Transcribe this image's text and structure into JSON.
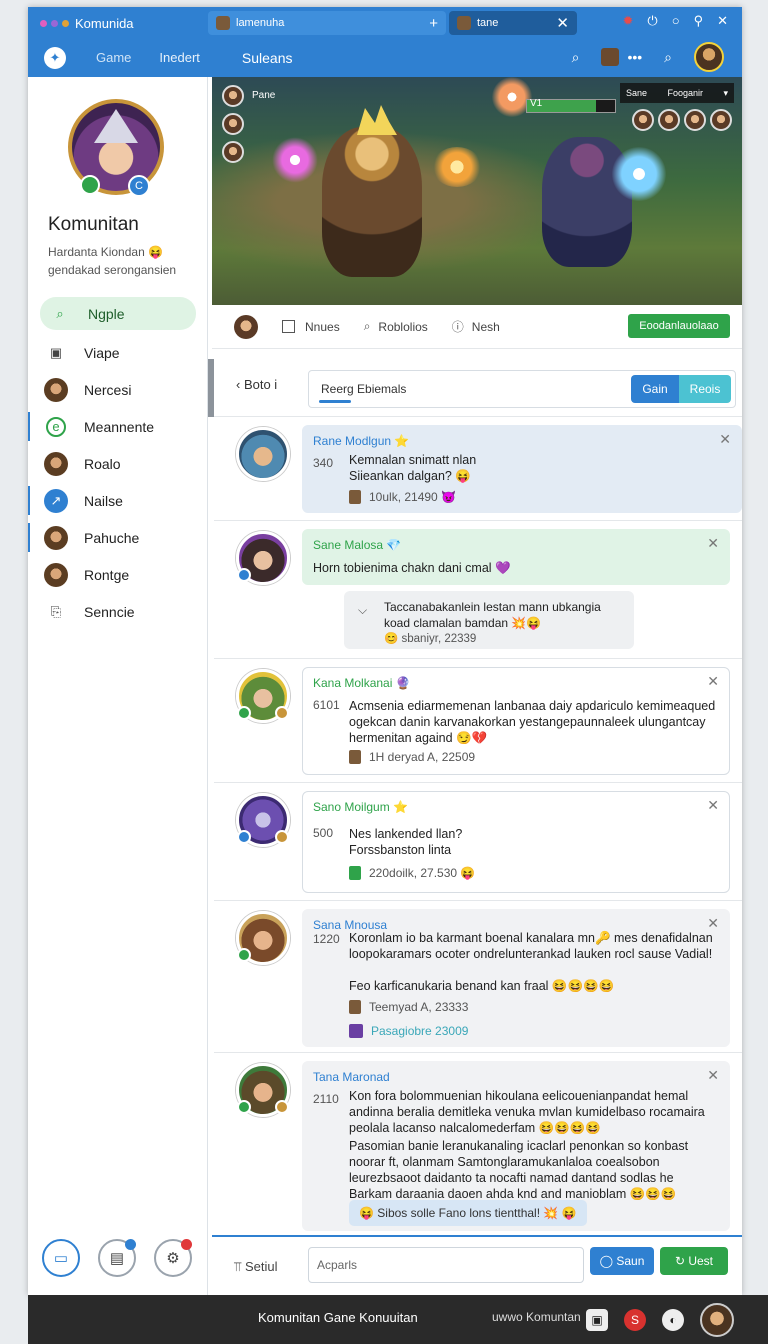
{
  "window": {
    "title": "Komunida",
    "tabs": [
      {
        "label": "lamenuha",
        "icon": "plus-icon"
      },
      {
        "label": "tane",
        "icon": "close-icon"
      }
    ],
    "dot_colors": [
      "#e05fbf",
      "#9a67d6",
      "#e0a238"
    ]
  },
  "toolbar": {
    "nav": [
      "Game",
      "Inedert"
    ],
    "title": "Suleans"
  },
  "profile": {
    "name": "Komunitan",
    "subtitle": "Hardanta Kiondan 😝 gendakad serongansien",
    "badge_b": "C"
  },
  "sidebar": {
    "items": [
      {
        "label": "Ngple",
        "icon": "search-icon",
        "active": true
      },
      {
        "label": "Viape",
        "icon": "calendar-icon"
      },
      {
        "label": "Nercesi",
        "icon": "avatar-icon"
      },
      {
        "label": "Meannente",
        "icon": "circle-icon"
      },
      {
        "label": "Roalo",
        "icon": "avatar-icon"
      },
      {
        "label": "Nailse",
        "icon": "share-icon"
      },
      {
        "label": "Pahuche",
        "icon": "avatar-icon"
      },
      {
        "label": "Rontge",
        "icon": "avatar-icon"
      },
      {
        "label": "Senncie",
        "icon": "clipboard-icon"
      }
    ]
  },
  "banner": {
    "player_name": "Pane",
    "hp_label": "V1",
    "hp_fraction": 0.78,
    "box_left": "Sane",
    "box_right": "Fooganir"
  },
  "actions": {
    "items": [
      "Nnues",
      "Roblolios",
      "Nesh"
    ],
    "button": "Eoodanlauolaao"
  },
  "feed": {
    "back": "Boto i",
    "search": "Reerg Ebiemals",
    "seg": [
      "Gain",
      "Reois"
    ]
  },
  "posts": [
    {
      "name": "Rane Modlgun ⭐",
      "num": "340",
      "text": "Kemnalan snimatt nlan Siieankan dalgan? 😝",
      "meta": "10ulk, 21490 😈"
    },
    {
      "name": "Sane Malosa 💎",
      "text": "Horn tobienima chakn dani cmal 💜",
      "reply_text": "Taccanabakanlein lestan mann ubkangia koad clamalan bamdan 💥😝",
      "reply_meta": "😊 sbaniyr, 22339"
    },
    {
      "name": "Kana Molkanai 🔮",
      "num": "6101",
      "text": "Acmsenia ediarmemenan lanbanaa daiy apdariculo kemimeaqued ogekcan danin karvanakorkan yestangepaunnaleek ulungantcay hermenitan againd 😏💔",
      "meta": "1H deryad A, 22509"
    },
    {
      "name": "Sano Moilgum ⭐",
      "num": "500",
      "text": "Nes lankended llan? Forssbanston linta",
      "meta": "220doilk, 27.530 😝"
    },
    {
      "name": "Sana Mnousa",
      "num": "1220",
      "text": "Koronlam io ba karmant boenal kanalara mn🔑 mes denafidalnan loopokaramars ocoter ondrelunterankad lauken rocl sause Vadial!",
      "text2": "Feo karficanukaria benand kan fraal 😆😆😆😆",
      "meta": "Teemyad A, 23333",
      "link": "Pasagiobre 23009"
    },
    {
      "name": "Tana Maronad",
      "num": "2110",
      "text": "Kon fora bolommuenian hikoulana eelicouenianpandat hemal andinna beralia demitleka venuka mvlan kumidelbaso rocamaira peolala lacanso nalcalomederfam 😆😆😆😆",
      "text2": "Pasomian banie leranukanaling icaclarl penonkan so konbast noorar ft, olanmam Samtonglaramukanlaloa coealsobon leurezbsaoot daidanto ta nocafti namad dantand sodlas he Barkam daraania daoen ahda knd and manioblam 😆😆😆",
      "chip": "😝 Sibos solle Fano lons tientthal! 💥 😝"
    }
  ],
  "composer": {
    "label": "Setiul",
    "placeholder": "Acparls",
    "btn1": "Saun",
    "btn2": "Uest"
  },
  "taskbar": {
    "title": "Komunitan Gane Konuuitan",
    "url": "uwwo Komuntan"
  }
}
